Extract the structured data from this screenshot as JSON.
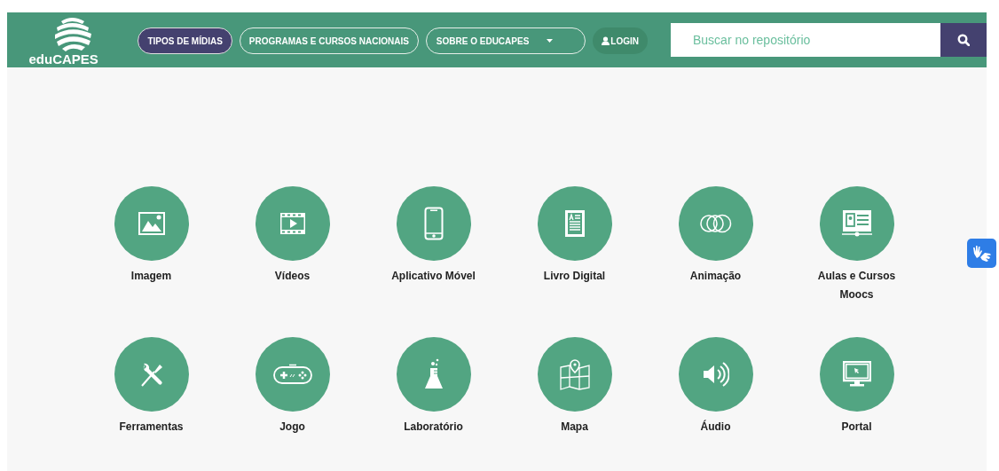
{
  "header": {
    "logo_text": "eduCAPES",
    "nav": [
      {
        "kind": "link",
        "label": "TIPOS DE MÍDIAS",
        "selected": true
      },
      {
        "kind": "link",
        "label": "PROGRAMAS E CURSOS NACIONAIS",
        "selected": false
      },
      {
        "kind": "dropdown",
        "label": "SOBRE O EDUCAPES",
        "selected": false
      },
      {
        "kind": "login",
        "label": "LOGIN",
        "selected": false
      }
    ],
    "search": {
      "placeholder": "Buscar no repositório"
    }
  },
  "media_types": [
    {
      "label": "Imagem"
    },
    {
      "label": "Vídeos"
    },
    {
      "label": "Aplicativo Móvel"
    },
    {
      "label": "Livro Digital"
    },
    {
      "label": "Animação"
    },
    {
      "label": "Aulas e Cursos Moocs"
    },
    {
      "label": "Ferramentas"
    },
    {
      "label": "Jogo"
    },
    {
      "label": "Laboratório"
    },
    {
      "label": "Mapa"
    },
    {
      "label": "Áudio"
    },
    {
      "label": "Portal"
    }
  ]
}
